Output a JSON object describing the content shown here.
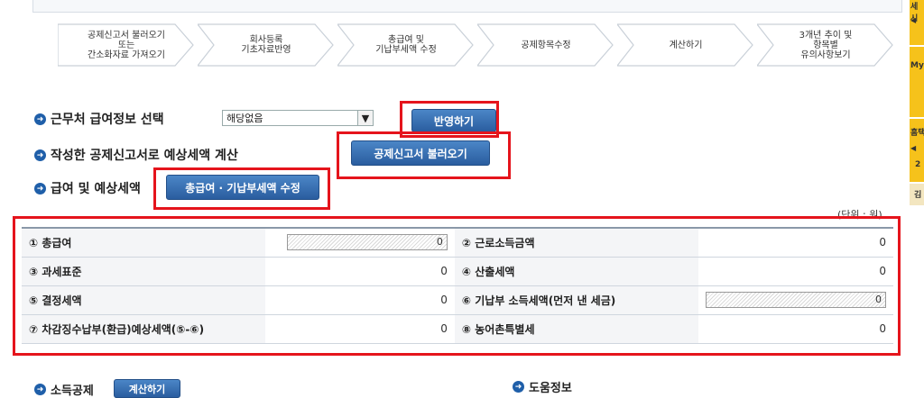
{
  "steps": [
    "공제신고서 불러오기\n또는\n간소화자료 가져오기",
    "회사등록\n기초자료반영",
    "총급여 및\n기납부세액 수정",
    "공제항목수정",
    "계산하기",
    "3개년 추이 및\n항목별\n유의사항보기"
  ],
  "section1": {
    "title": "근무처 급여정보 선택",
    "select_value": "해당없음",
    "apply_button": "반영하기"
  },
  "section2": {
    "title": "작성한 공제신고서로 예상세액 계산",
    "load_button": "공제신고서 불러오기"
  },
  "section3": {
    "title": "급여 및 예상세액",
    "edit_button": "총급여 · 기납부세액 수정"
  },
  "unit_label": "(단위 : 원)",
  "table": {
    "rows": [
      {
        "l1": "① 총급여",
        "v1": "0",
        "l2": "② 근로소득금액",
        "v2": "0"
      },
      {
        "l1": "③ 과세표준",
        "v1": "0",
        "l2": "④ 산출세액",
        "v2": "0"
      },
      {
        "l1": "⑤ 결정세액",
        "v1": "0",
        "l2": "⑥ 기납부 소득세액(먼저 낸 세금)",
        "v2": "0"
      },
      {
        "l1": "⑦ 차감징수납부(환급)예상세액(⑤-⑥)",
        "v1": "0",
        "l2": "⑧ 농어촌특별세",
        "v2": "0"
      }
    ]
  },
  "bottom": {
    "deduction_title": "소득공제",
    "calc_button": "계산하기",
    "help_title": "도움정보"
  },
  "sidebar": {
    "t1": "세\n시",
    "t2": "My",
    "t3": "홈택",
    "t4": "2",
    "t5": "김"
  },
  "colors": {
    "accent_blue": "#1f5fa9",
    "highlight_red": "#e5141c",
    "sidebar_orange": "#f6c21b"
  }
}
